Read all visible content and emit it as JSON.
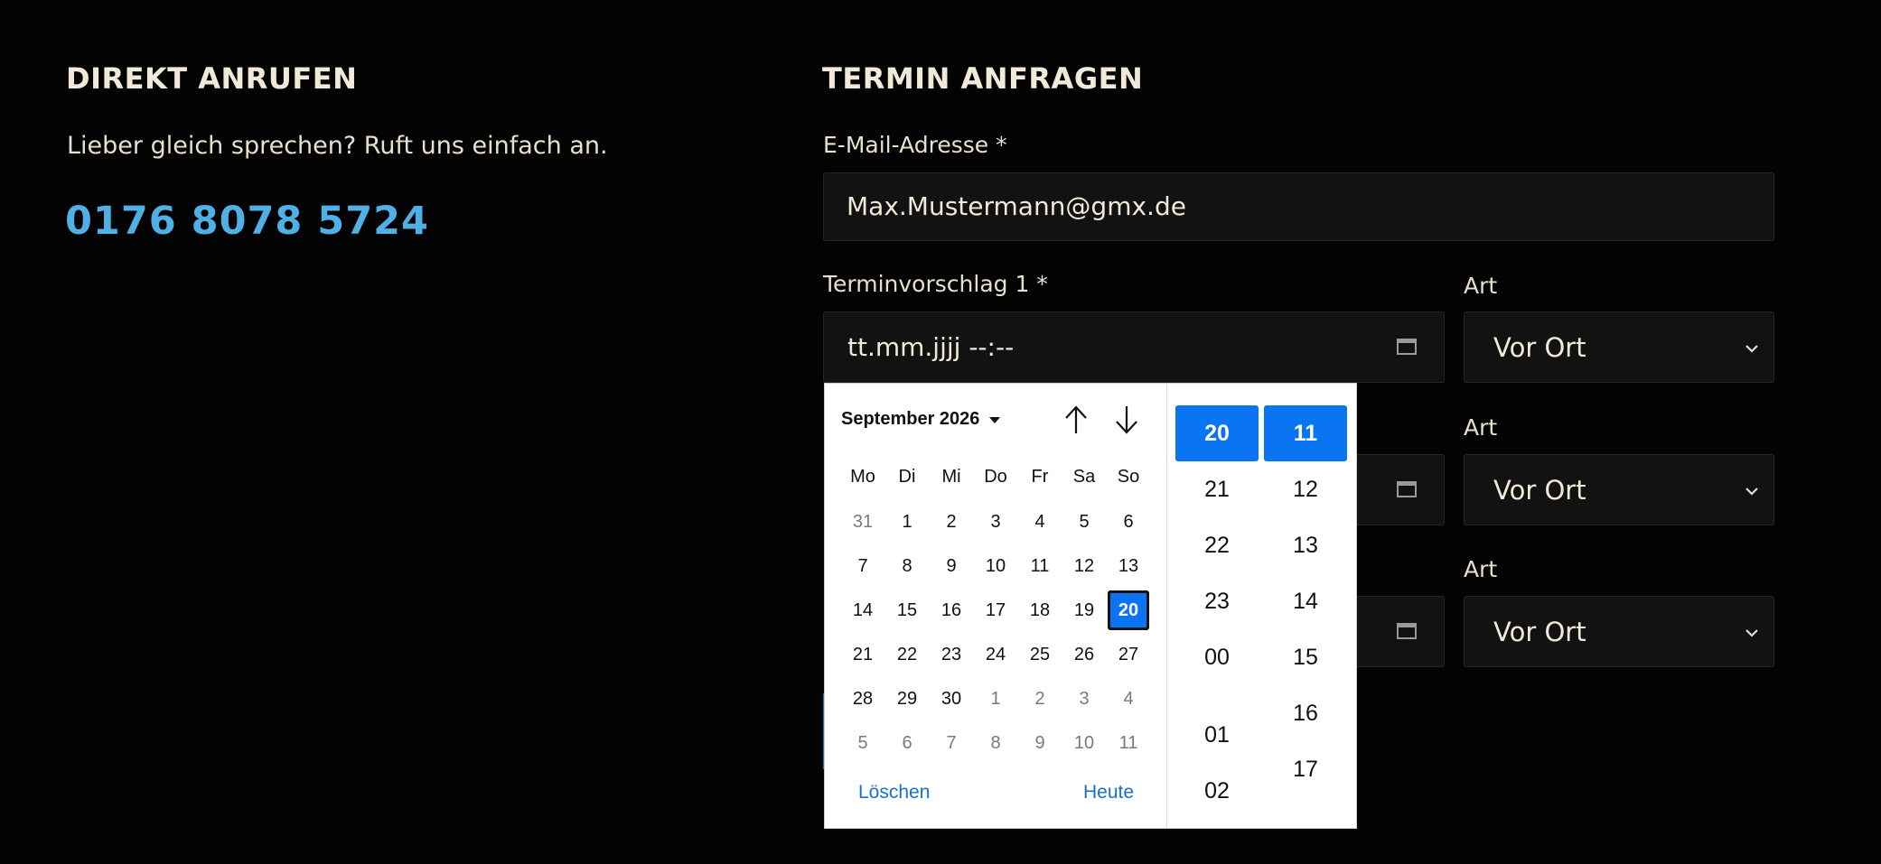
{
  "call": {
    "heading": "DIREKT ANRUFEN",
    "text": "Lieber gleich sprechen? Ruft uns einfach an.",
    "phone": "0176 8078 5724"
  },
  "form": {
    "heading": "TERMIN ANFRAGEN",
    "email": {
      "label": "E-Mail-Adresse *",
      "value": "Max.Mustermann@gmx.de"
    },
    "proposal1": {
      "label": "Terminvorschlag 1 *",
      "placeholder": "tt.mm.jjjj --:--"
    },
    "art_label": "Art",
    "art_value": "Vor Ort",
    "colors": {
      "accent": "#0a74f3",
      "phone": "#4fb0e6",
      "field_bg": "#121212"
    }
  },
  "picker": {
    "month_label": "September 2026",
    "weekdays": [
      "Mo",
      "Di",
      "Mi",
      "Do",
      "Fr",
      "Sa",
      "So"
    ],
    "weeks": [
      [
        "31",
        "1",
        "2",
        "3",
        "4",
        "5",
        "6"
      ],
      [
        "7",
        "8",
        "9",
        "10",
        "11",
        "12",
        "13"
      ],
      [
        "14",
        "15",
        "16",
        "17",
        "18",
        "19",
        "20"
      ],
      [
        "21",
        "22",
        "23",
        "24",
        "25",
        "26",
        "27"
      ],
      [
        "28",
        "29",
        "30",
        "1",
        "2",
        "3",
        "4"
      ],
      [
        "5",
        "6",
        "7",
        "8",
        "9",
        "10",
        "11"
      ]
    ],
    "clear_label": "Löschen",
    "today_label": "Heute",
    "hours": [
      "20",
      "21",
      "22",
      "23",
      "00",
      "01",
      "02"
    ],
    "minutes": [
      "11",
      "12",
      "13",
      "14",
      "15",
      "16",
      "17"
    ],
    "icons": [
      "arrow-up-icon",
      "arrow-down-icon",
      "caret-down-icon",
      "calendar-icon",
      "chevron-down-icon"
    ]
  }
}
